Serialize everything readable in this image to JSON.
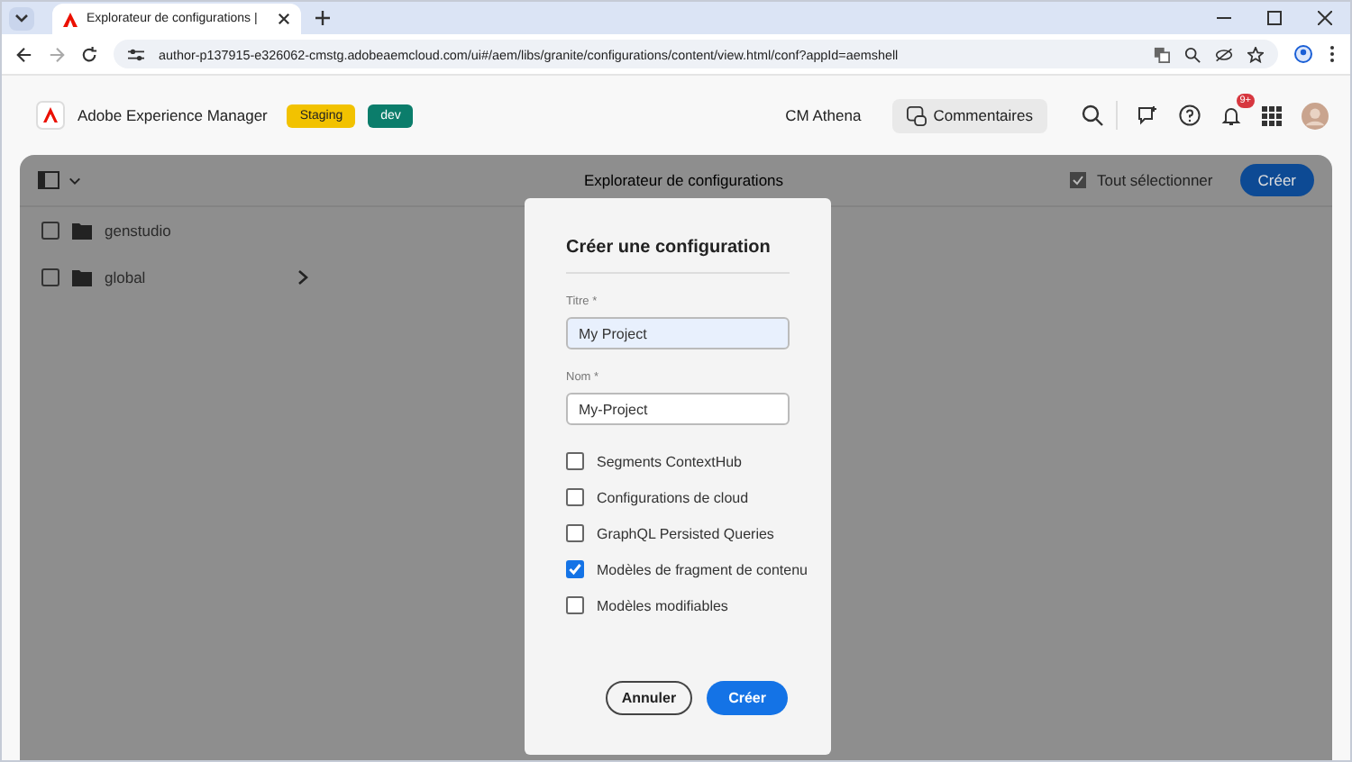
{
  "browser": {
    "tab_title": "Explorateur de configurations |",
    "url": "author-p137915-e326062-cmstg.adobeaemcloud.com/ui#/aem/libs/granite/configurations/content/view.html/conf?appId=aemshell"
  },
  "header": {
    "app_name": "Adobe Experience Manager",
    "badges": [
      {
        "label": "Staging",
        "color": "#f2c200"
      },
      {
        "label": "dev",
        "color": "#0b7d6b"
      }
    ],
    "org": "CM Athena",
    "feedback": "Commentaires",
    "notifications": "9+"
  },
  "toolbar": {
    "title": "Explorateur de configurations",
    "select_all": "Tout sélectionner",
    "create": "Créer"
  },
  "items": [
    {
      "name": "genstudio",
      "checked": false,
      "expandable": false
    },
    {
      "name": "global",
      "checked": false,
      "expandable": true
    }
  ],
  "dialog": {
    "title": "Créer une configuration",
    "fields": [
      {
        "label": "Titre *",
        "value": "My Project",
        "focused": true
      },
      {
        "label": "Nom *",
        "value": "My-Project",
        "focused": false
      }
    ],
    "options": [
      {
        "label": "Segments ContextHub",
        "checked": false
      },
      {
        "label": "Configurations de cloud",
        "checked": false
      },
      {
        "label": "GraphQL Persisted Queries",
        "checked": false
      },
      {
        "label": "Modèles de fragment de contenu",
        "checked": true
      },
      {
        "label": "Modèles modifiables",
        "checked": false
      }
    ],
    "cancel": "Annuler",
    "confirm": "Créer"
  }
}
